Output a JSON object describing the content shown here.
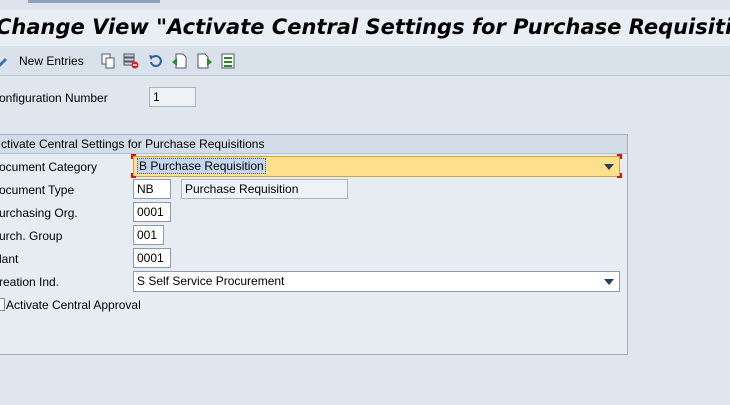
{
  "title": "Change View \"Activate Central Settings for Purchase Requisitions\": Det",
  "toolbar": {
    "new_entries_label": "New Entries",
    "icons": [
      "edit-pencil-icon",
      "copy-icon",
      "delete-icon",
      "undo-icon",
      "previous-entry-icon",
      "next-entry-icon",
      "select-all-icon"
    ]
  },
  "config": {
    "label": "onfiguration Number",
    "value": "1"
  },
  "group": {
    "title": "ctivate Central Settings for Purchase Requisitions",
    "doc_category": {
      "label": "ocument Category",
      "value": "B Purchase Requisition"
    },
    "doc_type": {
      "label": "ocument Type",
      "value": "NB",
      "description": "Purchase Requisition"
    },
    "purch_org": {
      "label": "urchasing Org.",
      "value": "0001"
    },
    "purch_group": {
      "label": "urch. Group",
      "value": "001"
    },
    "plant": {
      "label": "lant",
      "value": "0001"
    },
    "creation_ind": {
      "label": "reation Ind.",
      "value": "S Self Service Procurement"
    },
    "central_approval": {
      "label": "Activate Central Approval",
      "checked": false
    }
  }
}
